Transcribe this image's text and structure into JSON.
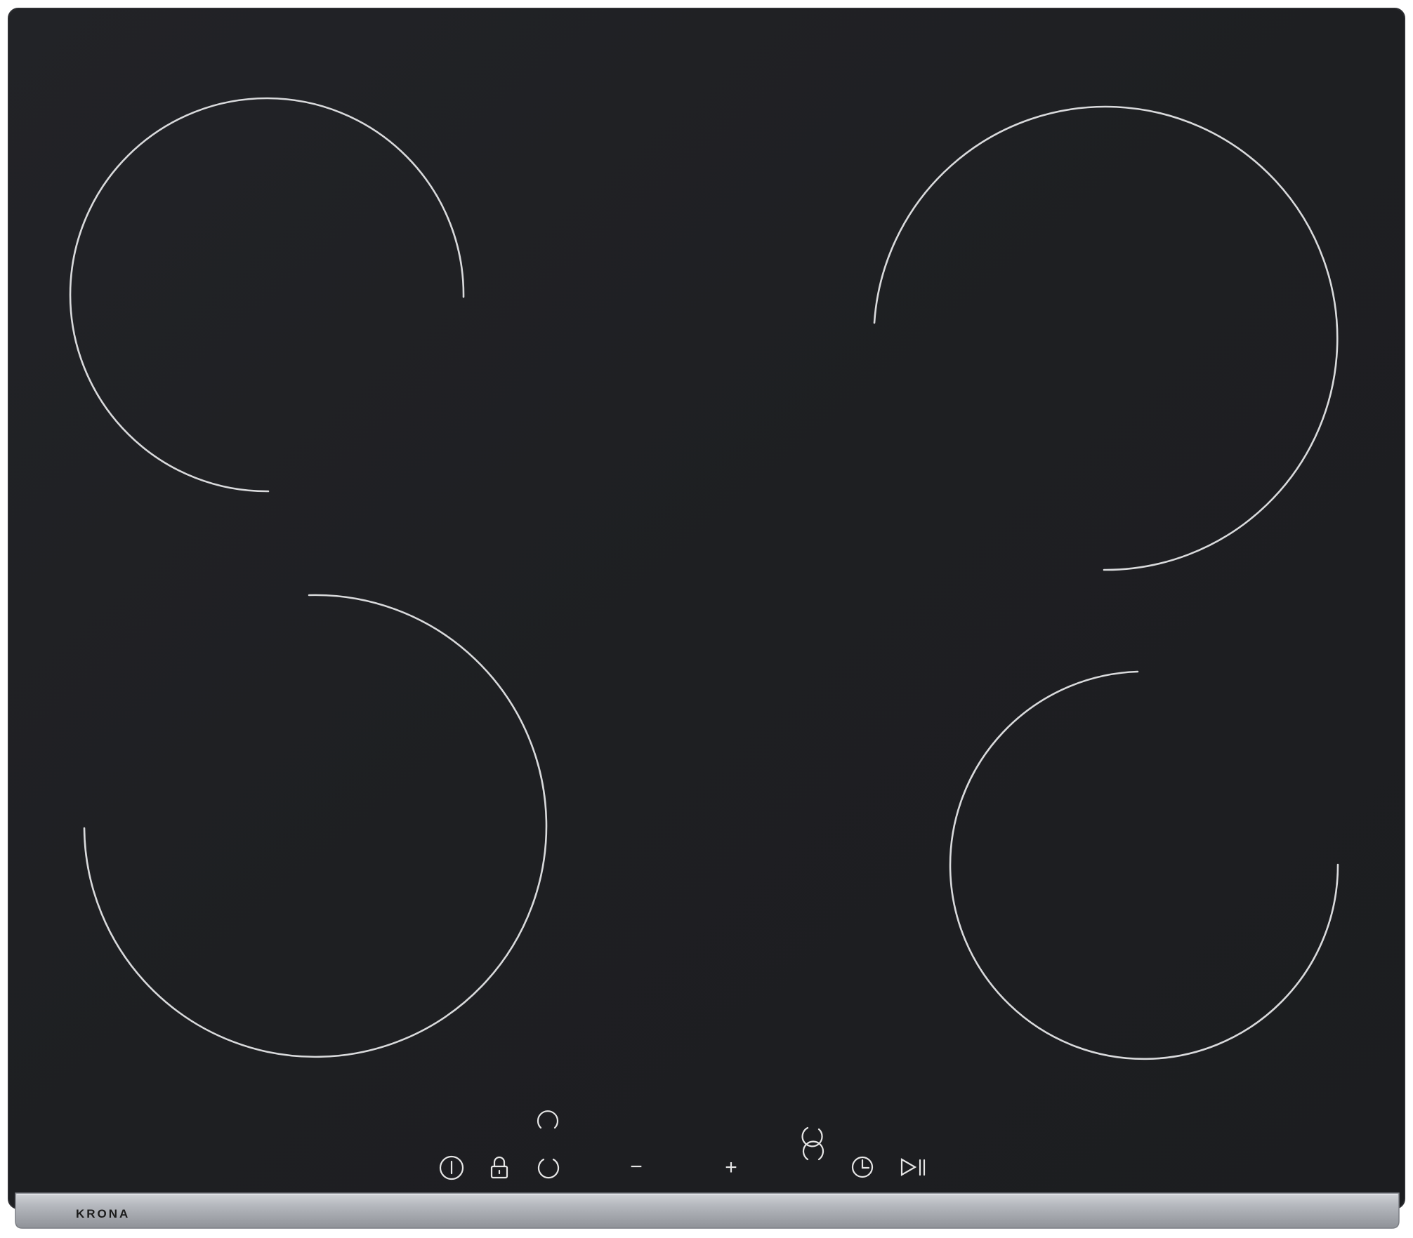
{
  "appliance": {
    "brand": "KRONA",
    "colors": {
      "glass": "#1f2023",
      "glass_edge": "#2a2b2f",
      "zone_ring": "#d9dadc",
      "control_icon": "#e6e6e6",
      "trim_strip": "#b9bcc2",
      "brand_text": "#1a1a1a"
    }
  },
  "cooking_zones": [
    {
      "name": "rear-left"
    },
    {
      "name": "rear-right"
    },
    {
      "name": "front-left"
    },
    {
      "name": "front-right"
    }
  ],
  "control_panel": {
    "zone_select_rear_left_icon": "zone-select-arc-icon",
    "zone_select_rear_right_icon": "zone-select-arc-icon",
    "power_icon": "power-icon",
    "lock_icon": "lock-icon",
    "zone_select_front_left_icon": "zone-select-arc-icon",
    "minus_label": "−",
    "plus_label": "+",
    "zone_select_front_right_icon": "zone-select-arc-icon",
    "timer_icon": "clock-icon",
    "pause_icon": "play-pause-icon"
  }
}
